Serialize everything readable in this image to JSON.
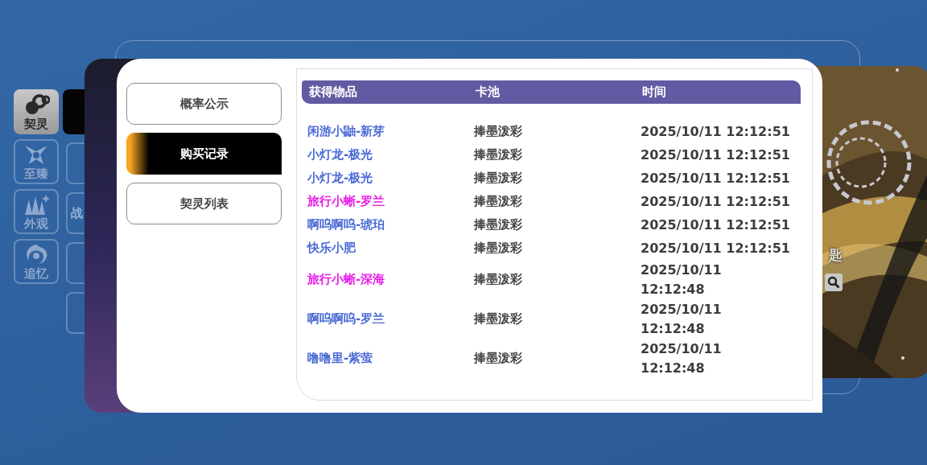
{
  "nav": [
    {
      "label": "契灵",
      "selected": true
    },
    {
      "label": "至臻",
      "selected": false
    },
    {
      "label": "外观",
      "selected": false
    },
    {
      "label": "追忆",
      "selected": false
    }
  ],
  "secondary_tabs": [
    {
      "selected": true
    },
    {
      "selected": false
    },
    {
      "label": "战",
      "selected": false
    },
    {
      "selected": false
    },
    {
      "selected": false
    }
  ],
  "banner": {
    "title": "匙"
  },
  "menu": [
    {
      "label": "概率公示",
      "selected": false
    },
    {
      "label": "购买记录",
      "selected": true
    },
    {
      "label": "契灵列表",
      "selected": false
    }
  ],
  "table": {
    "columns": [
      "获得物品",
      "卡池",
      "时间"
    ],
    "rows": [
      {
        "item": "闲游小鼬-新芽",
        "color": "#4a6ad6",
        "pool": "捧墨泼彩",
        "time": "2025/10/11 12:12:51",
        "wrapped": false
      },
      {
        "item": "小灯龙-极光",
        "color": "#4a6ad6",
        "pool": "捧墨泼彩",
        "time": "2025/10/11 12:12:51",
        "wrapped": false
      },
      {
        "item": "小灯龙-极光",
        "color": "#4a6ad6",
        "pool": "捧墨泼彩",
        "time": "2025/10/11 12:12:51",
        "wrapped": false
      },
      {
        "item": "旅行小蜥-罗兰",
        "color": "#e81ee8",
        "pool": "捧墨泼彩",
        "time": "2025/10/11 12:12:51",
        "wrapped": false
      },
      {
        "item": "啊呜啊呜-琥珀",
        "color": "#4a6ad6",
        "pool": "捧墨泼彩",
        "time": "2025/10/11 12:12:51",
        "wrapped": false
      },
      {
        "item": "快乐小肥",
        "color": "#4a6ad6",
        "pool": "捧墨泼彩",
        "time": "2025/10/11 12:12:51",
        "wrapped": false
      },
      {
        "item": "旅行小蜥-深海",
        "color": "#e81ee8",
        "pool": "捧墨泼彩",
        "time": "2025/10/11 12:12:48",
        "wrapped": true
      },
      {
        "item": "啊呜啊呜-罗兰",
        "color": "#4a6ad6",
        "pool": "捧墨泼彩",
        "time": "2025/10/11 12:12:48",
        "wrapped": true
      },
      {
        "item": "噜噜里-紫萤",
        "color": "#4a6ad6",
        "pool": "捧墨泼彩",
        "time": "2025/10/11 12:12:48",
        "wrapped": true
      }
    ]
  }
}
